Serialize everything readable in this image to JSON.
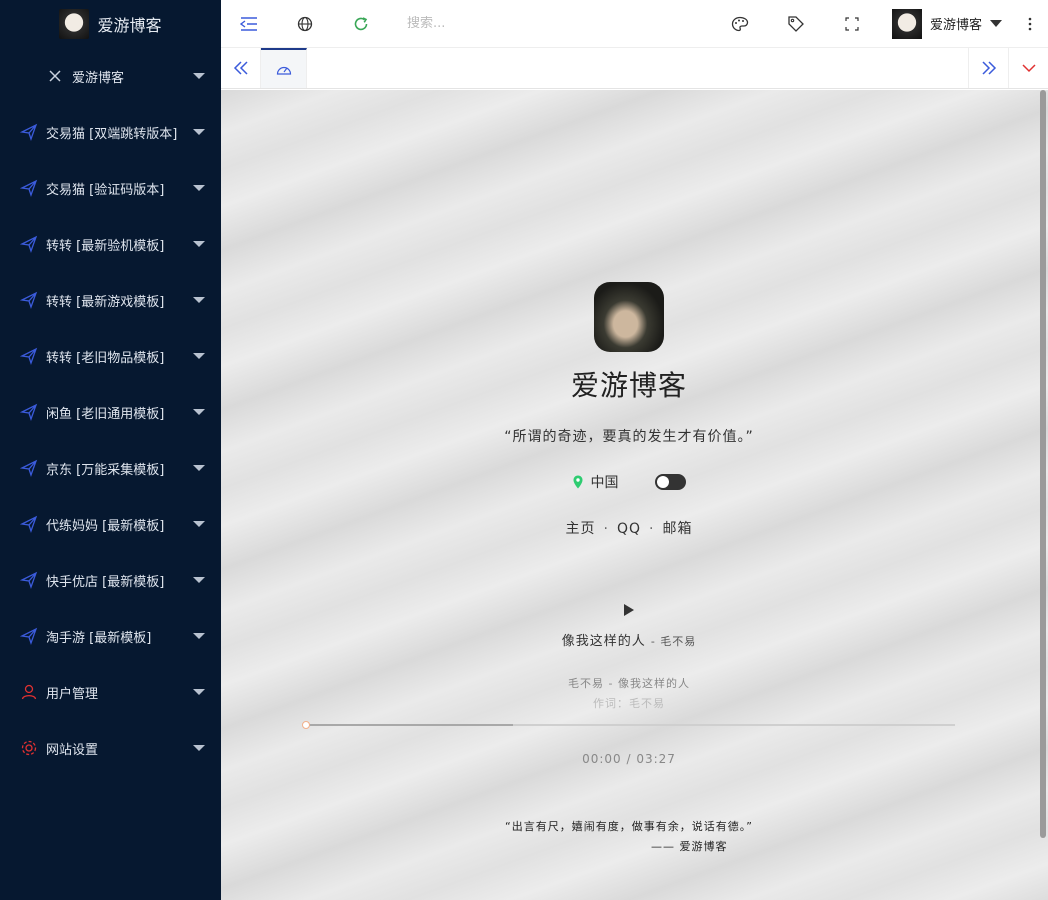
{
  "app": {
    "site_name": "爱游博客"
  },
  "sidebar": {
    "title": "爱游博客",
    "items": [
      {
        "label": "交易猫 [双端跳转版本]",
        "icon": "send-icon"
      },
      {
        "label": "交易猫 [验证码版本]",
        "icon": "send-icon"
      },
      {
        "label": "转转 [最新验机模板]",
        "icon": "send-icon"
      },
      {
        "label": "转转 [最新游戏模板]",
        "icon": "send-icon"
      },
      {
        "label": "转转 [老旧物品模板]",
        "icon": "send-icon"
      },
      {
        "label": "闲鱼 [老旧通用模板]",
        "icon": "send-icon"
      },
      {
        "label": "京东 [万能采集模板]",
        "icon": "send-icon"
      },
      {
        "label": "代练妈妈 [最新模板]",
        "icon": "send-icon"
      },
      {
        "label": "快手优店 [最新模板]",
        "icon": "send-icon"
      },
      {
        "label": "淘手游 [最新模板]",
        "icon": "send-icon"
      },
      {
        "label": "用户管理",
        "icon": "user-icon"
      },
      {
        "label": "网站设置",
        "icon": "gear-icon"
      }
    ]
  },
  "header": {
    "search_placeholder": "搜索...",
    "username": "爱游博客"
  },
  "profile": {
    "name": "爱游博客",
    "quote": "“所谓的奇迹，要真的发生才有价值。”",
    "location": "中国",
    "links": [
      "主页",
      "QQ",
      "邮箱"
    ]
  },
  "player": {
    "song": "像我这样的人",
    "artist": "- 毛不易",
    "lyric_current": "毛不易 - 像我这样的人",
    "lyric_next": "作词：毛不易",
    "time": "00:00 / 03:27",
    "buffered_fraction": 0.32
  },
  "footer": {
    "quote": "“出言有尺，嬉闹有度，做事有余，说话有德。”",
    "author": "—— 爱游博客"
  },
  "colors": {
    "sidebar_bg": "#061830",
    "accent_blue": "#3b5bdb",
    "refresh_green": "#3aa757",
    "location_green": "#2ecc71",
    "user_icon_red": "#e03131"
  }
}
